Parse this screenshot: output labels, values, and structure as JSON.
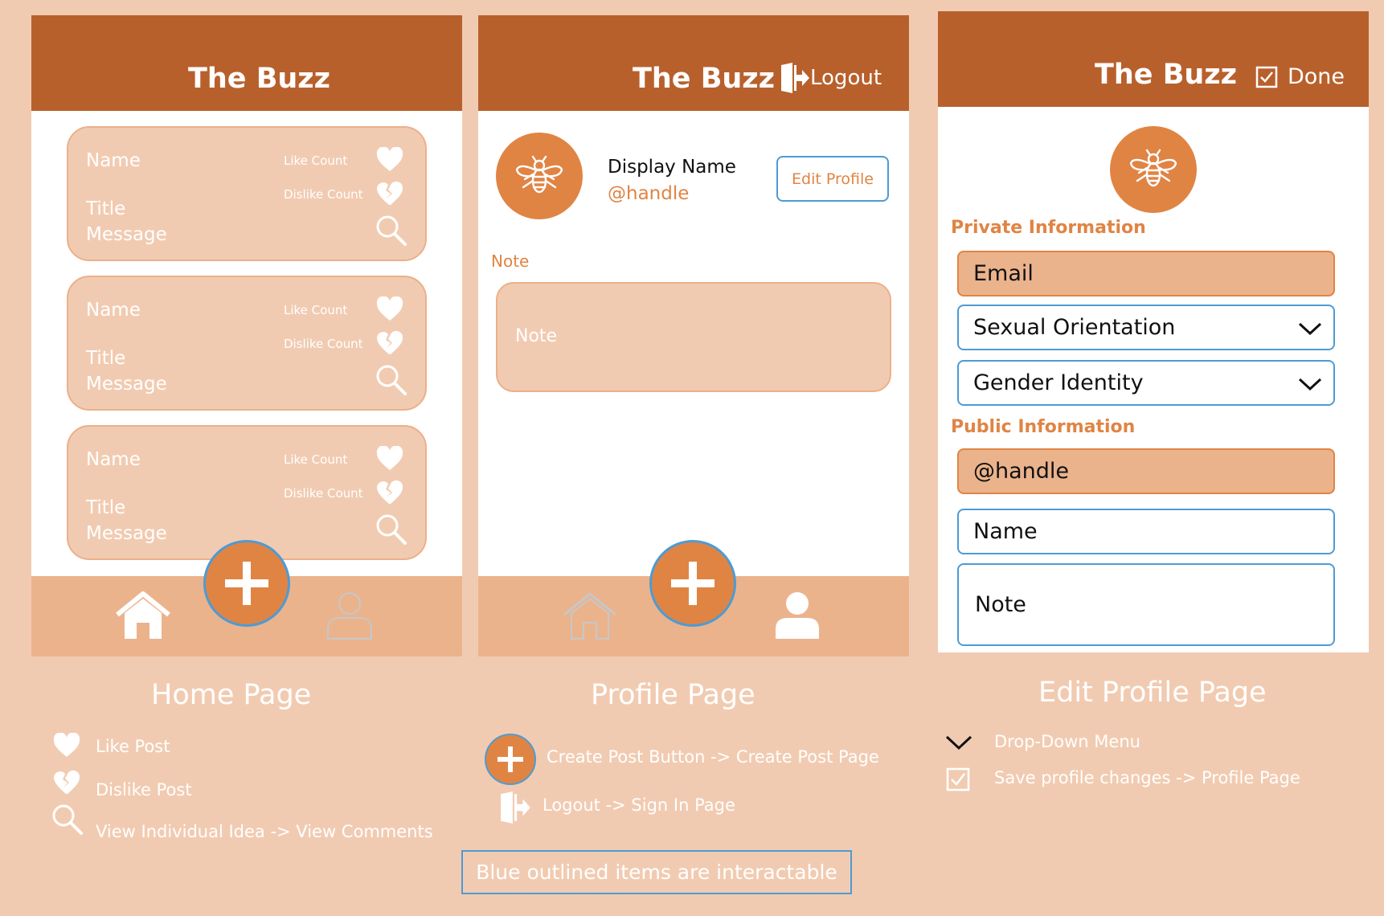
{
  "app_title": "The Buzz",
  "home": {
    "caption": "Home Page",
    "posts": [
      {
        "name": "Name",
        "title": "Title",
        "message": "Message",
        "like_count": "Like Count",
        "dislike_count": "Dislike Count"
      },
      {
        "name": "Name",
        "title": "Title",
        "message": "Message",
        "like_count": "Like Count",
        "dislike_count": "Dislike Count"
      },
      {
        "name": "Name",
        "title": "Title",
        "message": "Message",
        "like_count": "Like Count",
        "dislike_count": "Dislike Count"
      }
    ],
    "nav": [
      "home-icon",
      "create-post-icon",
      "profile-icon"
    ]
  },
  "profile": {
    "caption": "Profile Page",
    "logout_label": "Logout",
    "display_name": "Display Name",
    "handle": "@handle",
    "edit_profile_label": "Edit Profile",
    "note_heading": "Note",
    "note_placeholder": "Note"
  },
  "edit_profile": {
    "caption": "Edit Profile Page",
    "done_label": "Done",
    "private_heading": "Private Information",
    "email": "Email",
    "sexual_orientation": "Sexual Orientation",
    "gender_identity": "Gender Identity",
    "public_heading": "Public Information",
    "handle": "@handle",
    "name": "Name",
    "note": "Note"
  },
  "legend": {
    "home": [
      "Like Post",
      "Dislike Post",
      "View Individual Idea -> View Comments"
    ],
    "profile": [
      "Create Post Button -> Create Post Page",
      "Logout -> Sign In Page"
    ],
    "edit": [
      "Drop-Down Menu",
      "Save profile changes -> Profile Page"
    ],
    "note": "Blue outlined items are interactable"
  },
  "colors": {
    "background": "#f1cbb1",
    "header": "#b8602c",
    "accent": "#e08444",
    "nav": "#ebb38c",
    "interactable_outline": "#4d9bd5"
  }
}
